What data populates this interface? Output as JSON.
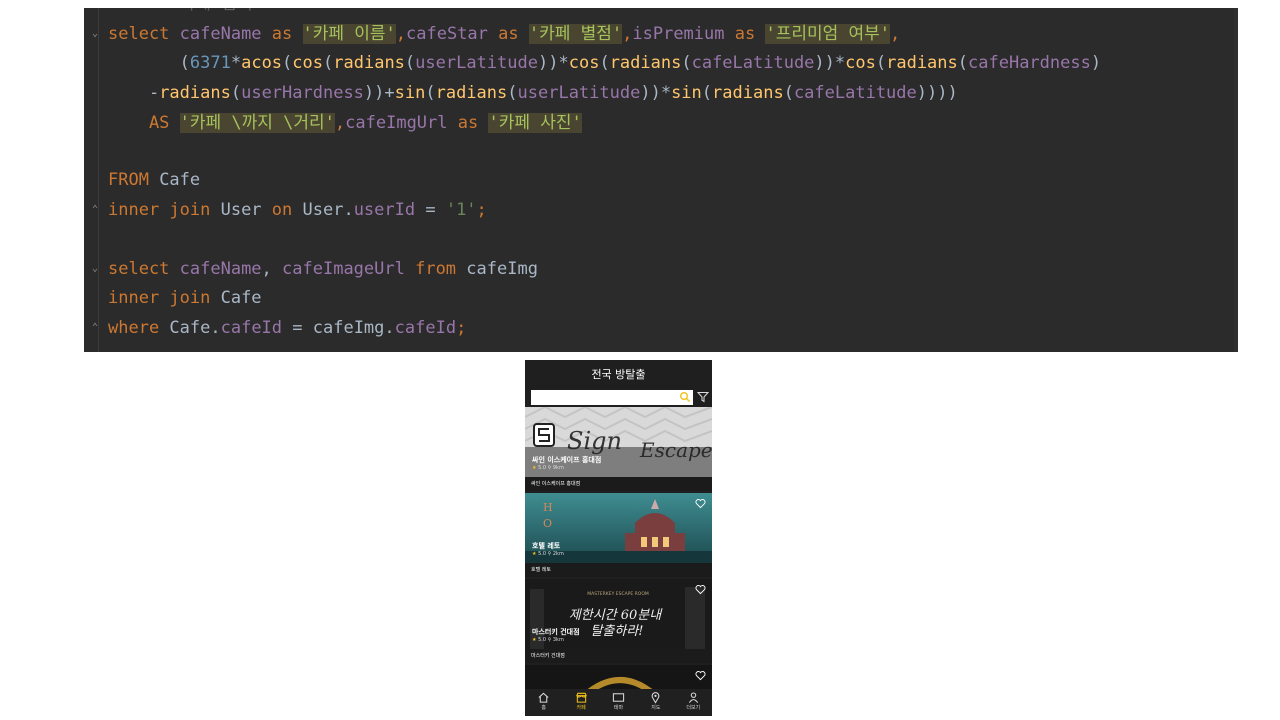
{
  "editor": {
    "lines": [
      {
        "segments": [
          {
            "t": "    -- 카페 검색",
            "c": "muted"
          }
        ]
      },
      {
        "segments": [
          {
            "t": "select ",
            "c": "kw"
          },
          {
            "t": "cafeName ",
            "c": "fld"
          },
          {
            "t": "as ",
            "c": "kw"
          },
          {
            "t": "'카페 이름'",
            "c": "alias"
          },
          {
            "t": ",",
            "c": "kw"
          },
          {
            "t": "cafeStar ",
            "c": "fld"
          },
          {
            "t": "as ",
            "c": "kw"
          },
          {
            "t": "'카페 별점'",
            "c": "alias"
          },
          {
            "t": ",",
            "c": "kw"
          },
          {
            "t": "isPremium ",
            "c": "fld"
          },
          {
            "t": "as ",
            "c": "kw"
          },
          {
            "t": "'프리미엄 여부'",
            "c": "alias"
          },
          {
            "t": ",",
            "c": "kw"
          }
        ]
      },
      {
        "segments": [
          {
            "t": "       (",
            "c": ""
          },
          {
            "t": "6371",
            "c": "num"
          },
          {
            "t": "*",
            "c": ""
          },
          {
            "t": "acos",
            "c": "fn"
          },
          {
            "t": "(",
            "c": ""
          },
          {
            "t": "cos",
            "c": "fn"
          },
          {
            "t": "(",
            "c": ""
          },
          {
            "t": "radians",
            "c": "fn"
          },
          {
            "t": "(",
            "c": ""
          },
          {
            "t": "userLatitude",
            "c": "fld"
          },
          {
            "t": "))*",
            "c": ""
          },
          {
            "t": "cos",
            "c": "fn"
          },
          {
            "t": "(",
            "c": ""
          },
          {
            "t": "radians",
            "c": "fn"
          },
          {
            "t": "(",
            "c": ""
          },
          {
            "t": "cafeLatitude",
            "c": "fld"
          },
          {
            "t": "))*",
            "c": ""
          },
          {
            "t": "cos",
            "c": "fn"
          },
          {
            "t": "(",
            "c": ""
          },
          {
            "t": "radians",
            "c": "fn"
          },
          {
            "t": "(",
            "c": ""
          },
          {
            "t": "cafeHardness",
            "c": "fld"
          },
          {
            "t": ")",
            "c": ""
          }
        ]
      },
      {
        "segments": [
          {
            "t": "    -",
            "c": ""
          },
          {
            "t": "radians",
            "c": "fn"
          },
          {
            "t": "(",
            "c": ""
          },
          {
            "t": "userHardness",
            "c": "fld"
          },
          {
            "t": "))+",
            "c": ""
          },
          {
            "t": "sin",
            "c": "fn"
          },
          {
            "t": "(",
            "c": ""
          },
          {
            "t": "radians",
            "c": "fn"
          },
          {
            "t": "(",
            "c": ""
          },
          {
            "t": "userLatitude",
            "c": "fld"
          },
          {
            "t": "))*",
            "c": ""
          },
          {
            "t": "sin",
            "c": "fn"
          },
          {
            "t": "(",
            "c": ""
          },
          {
            "t": "radians",
            "c": "fn"
          },
          {
            "t": "(",
            "c": ""
          },
          {
            "t": "cafeLatitude",
            "c": "fld"
          },
          {
            "t": "))))",
            "c": ""
          }
        ]
      },
      {
        "segments": [
          {
            "t": "    AS ",
            "c": "kw"
          },
          {
            "t": "'카페 \\까지 \\거리'",
            "c": "alias"
          },
          {
            "t": ",",
            "c": "kw"
          },
          {
            "t": "cafeImgUrl ",
            "c": "fld"
          },
          {
            "t": "as ",
            "c": "kw"
          },
          {
            "t": "'카페 사진'",
            "c": "alias"
          }
        ]
      },
      {
        "segments": []
      },
      {
        "segments": [
          {
            "t": "FROM ",
            "c": "kw"
          },
          {
            "t": "Cafe",
            "c": ""
          }
        ]
      },
      {
        "segments": [
          {
            "t": "inner join ",
            "c": "kw"
          },
          {
            "t": "User ",
            "c": ""
          },
          {
            "t": "on ",
            "c": "kw"
          },
          {
            "t": "User.",
            "c": ""
          },
          {
            "t": "userId",
            "c": "fld"
          },
          {
            "t": " = ",
            "c": ""
          },
          {
            "t": "'1'",
            "c": "str"
          },
          {
            "t": ";",
            "c": "kw"
          }
        ]
      },
      {
        "segments": []
      },
      {
        "segments": [
          {
            "t": "select ",
            "c": "kw"
          },
          {
            "t": "cafeName",
            "c": "fld"
          },
          {
            "t": ", ",
            "c": ""
          },
          {
            "t": "cafeImageUrl ",
            "c": "fld"
          },
          {
            "t": "from ",
            "c": "kw"
          },
          {
            "t": "cafeImg",
            "c": ""
          }
        ]
      },
      {
        "segments": [
          {
            "t": "inner join ",
            "c": "kw"
          },
          {
            "t": "Cafe",
            "c": ""
          }
        ]
      },
      {
        "segments": [
          {
            "t": "where ",
            "c": "kw"
          },
          {
            "t": "Cafe.",
            "c": ""
          },
          {
            "t": "cafeId",
            "c": "fld"
          },
          {
            "t": " = ",
            "c": ""
          },
          {
            "t": "cafeImg.",
            "c": ""
          },
          {
            "t": "cafeId",
            "c": "fld"
          },
          {
            "t": ";",
            "c": "kw"
          }
        ]
      }
    ]
  },
  "phone": {
    "title": "전국 방탈출",
    "search": {
      "placeholder": ""
    },
    "cards": [
      {
        "title": "싸인 이스케이프 홍대점",
        "rating": "5.0",
        "distance": "9km",
        "footer": "싸인 이스케이프 홍대점",
        "overlay_text": "Sign Escape",
        "theme": "sign"
      },
      {
        "title": "호텔 레토",
        "rating": "5.0",
        "distance": "2km",
        "footer": "호텔 레토",
        "overlay_text": "HOTEL",
        "theme": "hotel"
      },
      {
        "title": "마스터키 건대점",
        "rating": "5.0",
        "distance": "3km",
        "footer": "마스터키 건대점",
        "overlay_text": "제한시간 60분내 탈출하라!",
        "overlay_small": "MASTERKEY ESCAPE ROOM",
        "theme": "master"
      },
      {
        "title": "",
        "rating": "",
        "distance": "",
        "footer": "",
        "overlay_text": "",
        "theme": "gold"
      }
    ],
    "nav": [
      {
        "label": "홈",
        "icon": "home-icon"
      },
      {
        "label": "카페",
        "icon": "store-icon",
        "active": true
      },
      {
        "label": "테마",
        "icon": "theme-icon"
      },
      {
        "label": "지도",
        "icon": "map-pin-icon"
      },
      {
        "label": "더보기",
        "icon": "person-icon"
      }
    ],
    "accent_color": "#f3c11b"
  }
}
